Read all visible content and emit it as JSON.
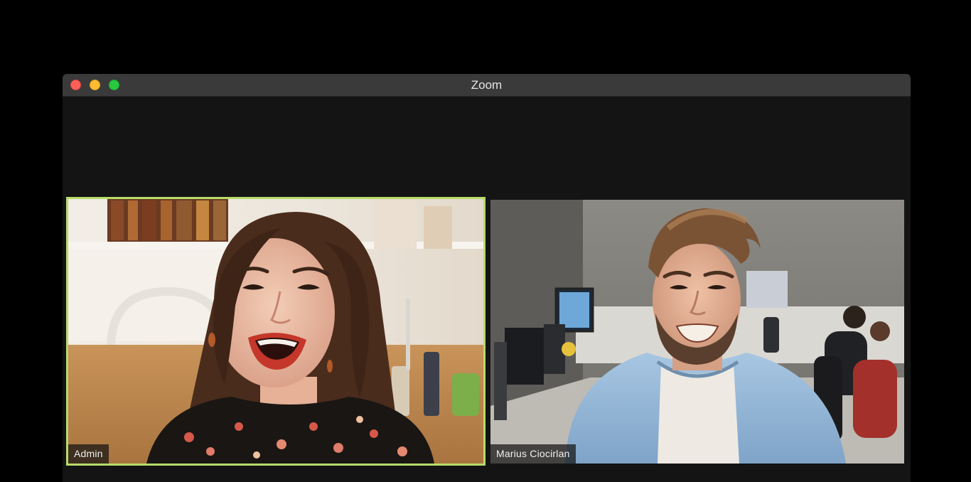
{
  "window": {
    "title": "Zoom",
    "controls": [
      "close-icon",
      "minimize-icon",
      "maximize-icon"
    ]
  },
  "participants": [
    {
      "name": "Admin",
      "active_speaker": true,
      "highlight_color": "#b7dc69"
    },
    {
      "name": "Marius Ciocirlan",
      "active_speaker": false
    }
  ]
}
